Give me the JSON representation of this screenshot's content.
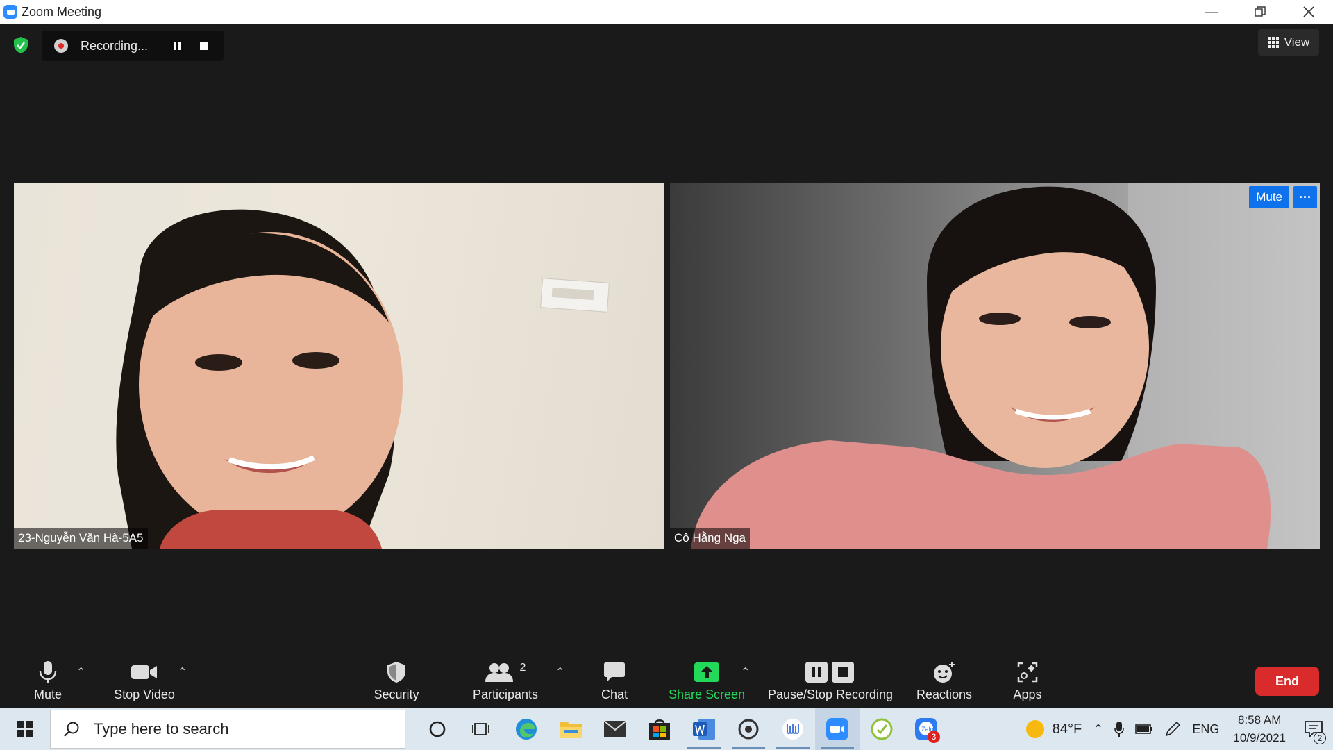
{
  "window": {
    "title": "Zoom Meeting"
  },
  "recording": {
    "text": "Recording..."
  },
  "view_button": {
    "label": "View"
  },
  "participants_tiles": [
    {
      "name": "23-Nguyễn Văn Hà-5A5"
    },
    {
      "name": "Cô Hằng Nga",
      "mute_label": "Mute",
      "more_label": "···"
    }
  ],
  "toolbar": {
    "mute": "Mute",
    "stop_video": "Stop Video",
    "security": "Security",
    "participants": "Participants",
    "participants_count": "2",
    "chat": "Chat",
    "share_screen": "Share Screen",
    "pause_stop_recording": "Pause/Stop Recording",
    "reactions": "Reactions",
    "apps": "Apps",
    "end": "End"
  },
  "taskbar": {
    "search_placeholder": "Type here to search",
    "weather_temp": "84°F",
    "language": "ENG",
    "time": "8:58 AM",
    "date": "10/9/2021",
    "zalo_badge": "3",
    "notification_count": "2"
  },
  "colors": {
    "zoom_blue": "#0e72ed",
    "share_green": "#23d959",
    "end_red": "#d92b2b"
  }
}
